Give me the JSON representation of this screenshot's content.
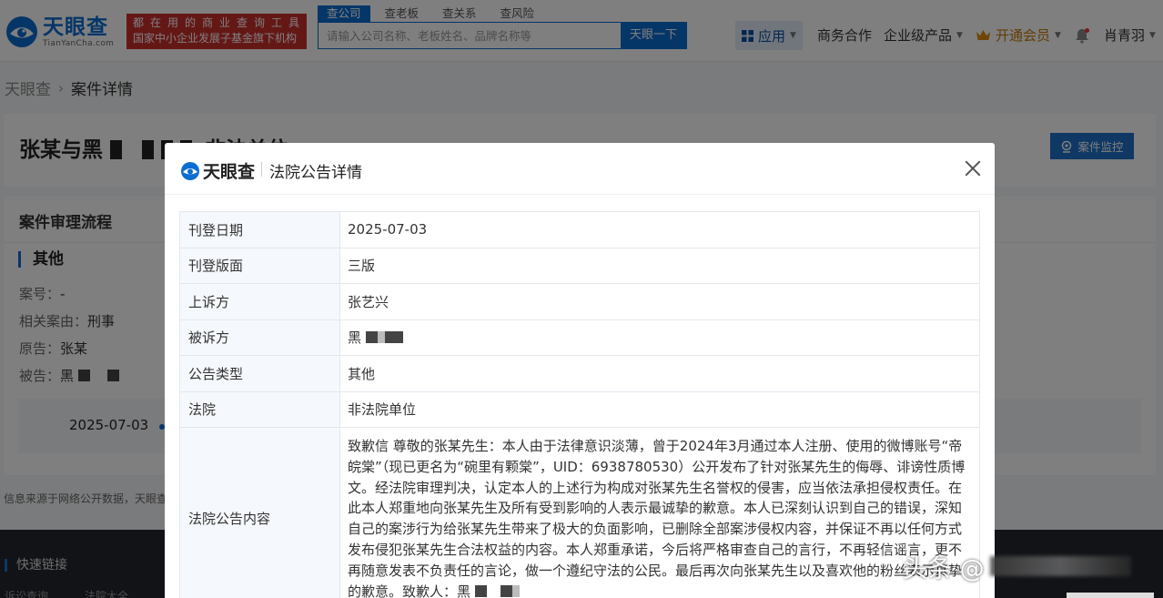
{
  "header": {
    "logo_cn": "天眼查",
    "logo_en": "TianYanCha.com",
    "slogan_line1": "都在用的商业查询工具",
    "slogan_line2": "国家中小企业发展子基金旗下机构",
    "search_tabs": [
      {
        "label": "查公司",
        "active": true
      },
      {
        "label": "查老板",
        "active": false
      },
      {
        "label": "查关系",
        "active": false
      },
      {
        "label": "查风险",
        "active": false
      }
    ],
    "search_placeholder": "请输入公司名称、老板姓名、品牌名称等",
    "search_button": "天眼一下",
    "nav": {
      "app": "应用",
      "business": "商务合作",
      "enterprise": "企业级产品",
      "vip": "开通会员",
      "user": "肖青羽"
    }
  },
  "breadcrumb": {
    "home": "天眼查",
    "current": "案件详情"
  },
  "case": {
    "title": "张某与黑",
    "title_tail": "非法单位",
    "monitor_button": "案件监控"
  },
  "process": {
    "section_title": "案件审理流程",
    "sub_title": "其他",
    "case_no_label": "案号：",
    "case_no": "-",
    "cause_label": "相关案由：",
    "cause": "刑事",
    "plaintiff_label": "原告：",
    "plaintiff": "张某",
    "defendant_label": "被告：",
    "defendant": "黑",
    "timeline_date": "2025-07-03"
  },
  "source_note": "信息来源于网络公开数据，天眼查",
  "footer": {
    "title": "快速链接",
    "links": [
      "诉讼查询",
      "法院大全"
    ]
  },
  "modal": {
    "logo_cn": "天眼查",
    "title": "法院公告详情",
    "rows": {
      "publish_date": {
        "label": "刊登日期",
        "value": "2025-07-03"
      },
      "page": {
        "label": "刊登版面",
        "value": "三版"
      },
      "appellant": {
        "label": "上诉方",
        "value": "张艺兴"
      },
      "respondent": {
        "label": "被诉方",
        "value": "黑"
      },
      "type": {
        "label": "公告类型",
        "value": "其他"
      },
      "court": {
        "label": "法院",
        "value": "非法院单位"
      },
      "content": {
        "label": "法院公告内容",
        "value": "致歉信 尊敬的张某先生：本人由于法律意识淡薄，曾于2024年3月通过本人注册、使用的微博账号“帝皖棠”（现已更名为“碗里有颗棠”，UID：6938780530）公开发布了针对张某先生的侮辱、诽谤性质博文。经法院审理判决，认定本人的上述行为构成对张某先生名誉权的侵害，应当依法承担侵权责任。在此本人郑重地向张某先生及所有受到影响的人表示最诚挚的歉意。本人已深刻认识到自己的错误，深知自己的案涉行为给张某先生带来了极大的负面影响，已删除全部案涉侵权内容，并保证不再以任何方式发布侵犯张某先生合法权益的内容。本人郑重承诺，今后将严格审查自己的言行，不再轻信谣言，更不再随意发表不负责任的言论，做一个遵纪守法的公民。最后再次向张某先生以及喜欢他的粉丝表示真挚的歉意。致歉人：黑"
      }
    }
  },
  "watermark": {
    "text": "头条 @"
  },
  "colors": {
    "brand_blue": "#0b6dd1",
    "slogan_red": "#c9302c",
    "vip_gold": "#c47a09"
  }
}
